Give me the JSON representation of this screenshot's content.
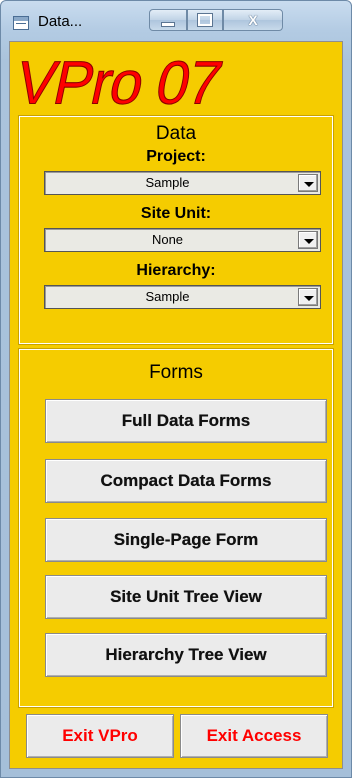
{
  "window": {
    "title": "Data...",
    "close_glyph": "X"
  },
  "logo": {
    "text": "VPro 07"
  },
  "data_section": {
    "title": "Data",
    "project_label": "Project:",
    "project_value": "Sample",
    "site_unit_label": "Site Unit:",
    "site_unit_value": "None",
    "hierarchy_label": "Hierarchy:",
    "hierarchy_value": "Sample"
  },
  "forms_section": {
    "title": "Forms",
    "buttons": [
      "Full Data Forms",
      "Compact Data Forms",
      "Single-Page Form",
      "Site Unit Tree View",
      "Hierarchy Tree View"
    ]
  },
  "exit": {
    "vpro_label": "Exit VPro",
    "access_label": "Exit Access"
  },
  "colors": {
    "background": "#f5cc00",
    "logo": "#ff0000",
    "exit_text": "#ff0000"
  }
}
